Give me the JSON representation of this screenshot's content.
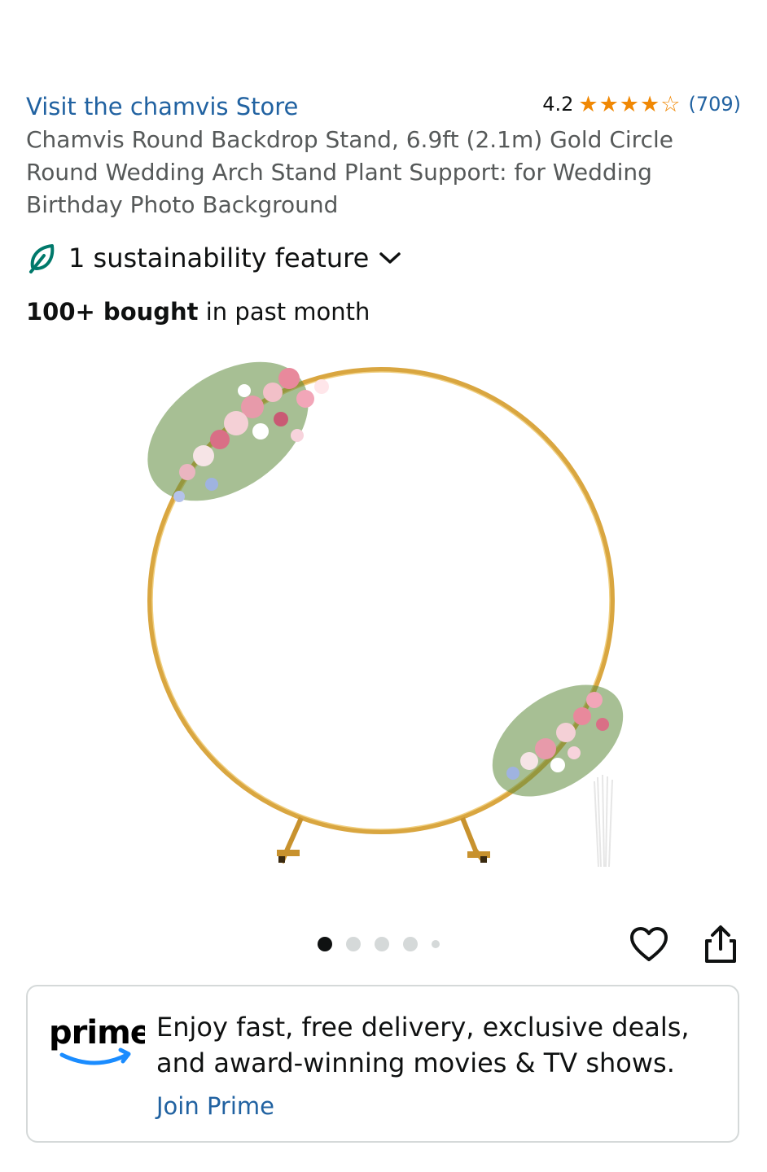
{
  "store": {
    "link_label": "Visit the chamvis Store"
  },
  "rating": {
    "value": "4.2",
    "stars": 4.2,
    "count": "(709)",
    "star_color": "#f08804"
  },
  "product": {
    "title": "Chamvis Round Backdrop Stand, 6.9ft (2.1m) Gold Circle Round Wedding Arch Stand Plant Support: for Wedding Birthday Photo Background"
  },
  "sustainability": {
    "label": "1 sustainability feature",
    "icon": "leaf-icon",
    "expand_icon": "chevron-down-icon"
  },
  "bought": {
    "bold": "100+ bought",
    "rest": " in past month"
  },
  "gallery": {
    "image_count": 5,
    "active_index": 0
  },
  "actions": {
    "wishlist_icon": "heart-icon",
    "share_icon": "share-icon"
  },
  "prime": {
    "logo": "prime",
    "message": "Enjoy fast, free delivery, exclusive deals, and award-winning movies & TV shows.",
    "join_label": "Join Prime",
    "brand_color": "#1a8cff"
  },
  "colors": {
    "link": "#2162a1",
    "text": "#0f1111",
    "muted": "#565959",
    "gold": "#d4a030"
  }
}
